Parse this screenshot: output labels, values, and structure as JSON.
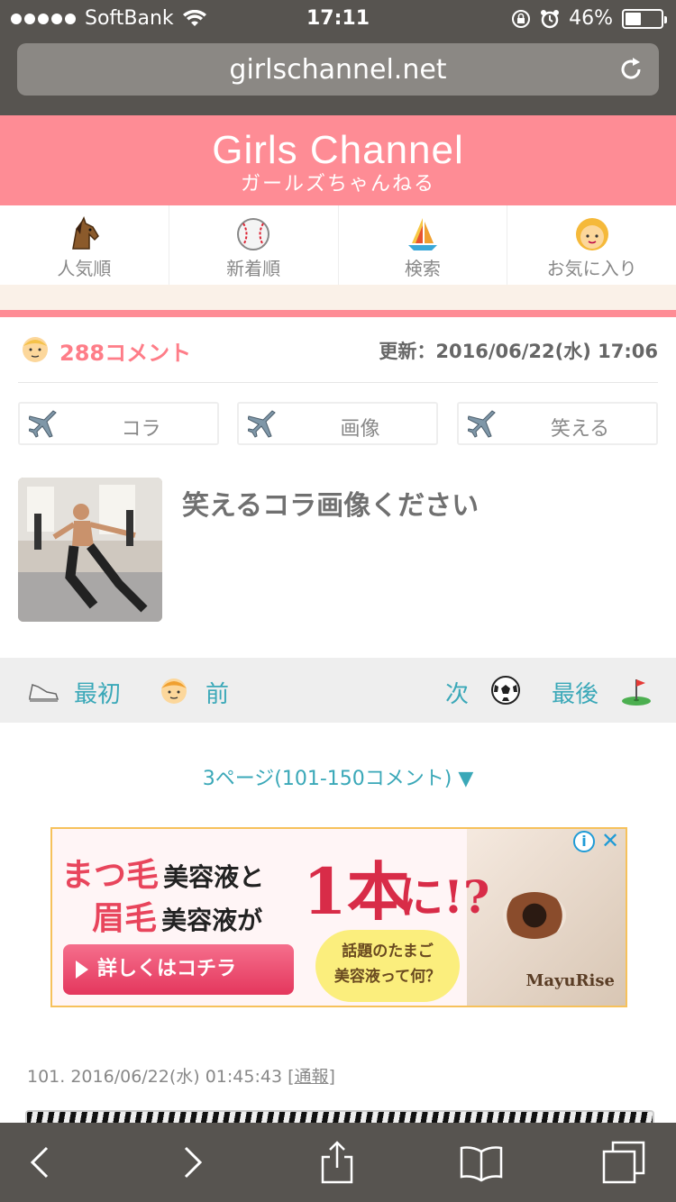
{
  "status_bar": {
    "carrier": "SoftBank",
    "time": "17:11",
    "battery_percent": "46%",
    "battery_level": 0.46
  },
  "address_bar": {
    "url": "girlschannel.net"
  },
  "header": {
    "logo": "Girls Channel",
    "logo_sub": "ガールズちゃんねる",
    "brand_color": "#fe8c95"
  },
  "nav": {
    "items": [
      {
        "label": "人気順",
        "icon": "horse-icon"
      },
      {
        "label": "新着順",
        "icon": "baseball-icon"
      },
      {
        "label": "検索",
        "icon": "sailboat-icon"
      },
      {
        "label": "お気に入り",
        "icon": "girl-face-icon"
      }
    ]
  },
  "topic_meta": {
    "comment_count": "288コメント",
    "updated": "更新：2016/06/22(水) 17:06"
  },
  "tags": [
    {
      "label": "コラ"
    },
    {
      "label": "画像"
    },
    {
      "label": "笑える"
    }
  ],
  "topic": {
    "title": "笑えるコラ画像ください"
  },
  "pager": {
    "first": "最初",
    "prev": "前",
    "next": "次",
    "last": "最後",
    "link_color": "#3aa8b8"
  },
  "page_select": {
    "label": "3ページ(101-150コメント) ▼"
  },
  "ad": {
    "line1_big": "まつ毛",
    "line1_small": "美容液と",
    "line2_big": "眉毛",
    "line2_small": "美容液が",
    "highlight_one": "1本",
    "highlight_ni": "に!?",
    "button_label": "詳しくはコチラ",
    "bubble_line1": "話題のたまご",
    "bubble_line2": "美容液って何？",
    "brand": "MayuRise",
    "info": "i",
    "close": "✕"
  },
  "comment": {
    "meta": "101.  2016/06/22(水) 01:45:43 ",
    "report": "[通報]"
  }
}
